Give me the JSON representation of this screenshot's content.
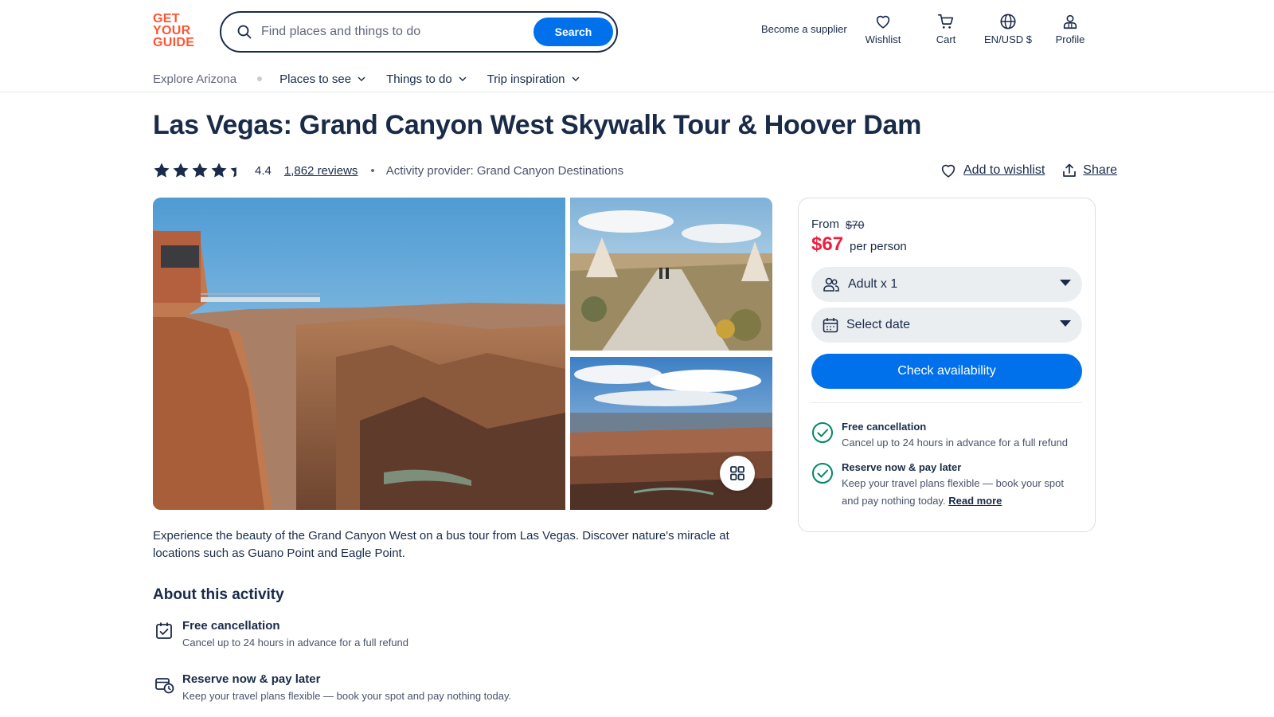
{
  "header": {
    "logo_lines": [
      "GET",
      "YOUR",
      "GUIDE"
    ],
    "search": {
      "placeholder": "Find places and things to do",
      "button_label": "Search"
    },
    "supplier_link": "Become a supplier",
    "nav": [
      {
        "label": "Wishlist",
        "icon": "heart-icon"
      },
      {
        "label": "Cart",
        "icon": "cart-icon"
      },
      {
        "label": "EN/USD $",
        "icon": "globe-icon"
      },
      {
        "label": "Profile",
        "icon": "profile-icon"
      }
    ]
  },
  "subnav": {
    "explore": "Explore Arizona",
    "items": [
      "Places to see",
      "Things to do",
      "Trip inspiration"
    ]
  },
  "activity": {
    "title": "Las Vegas: Grand Canyon West Skywalk Tour & Hoover Dam",
    "rating": "4.4",
    "rating_value": 4.4,
    "reviews": "1,862 reviews",
    "provider": "Activity provider: Grand Canyon Destinations",
    "add_to_wishlist": "Add to wishlist",
    "share": "Share",
    "description": "Experience the beauty of the Grand Canyon West on a bus tour from Las Vegas. Discover nature's miracle at locations such as Guano Point and Eagle Point."
  },
  "booking": {
    "from_label": "From",
    "old_price": "$70",
    "price": "$67",
    "per_person": "per person",
    "participants": "Adult x 1",
    "date": "Select date",
    "check_button": "Check availability",
    "perks": [
      {
        "title": "Free cancellation",
        "text": "Cancel up to 24 hours in advance for a full refund"
      },
      {
        "title": "Reserve now & pay later",
        "text": "Keep your travel plans flexible — book your spot and pay nothing today.",
        "link": "Read more"
      }
    ]
  },
  "about": {
    "heading": "About this activity",
    "items": [
      {
        "title": "Free cancellation",
        "text": "Cancel up to 24 hours in advance for a full refund"
      },
      {
        "title": "Reserve now & pay later",
        "text": "Keep your travel plans flexible — book your spot and pay nothing today."
      }
    ]
  },
  "colors": {
    "brand": "#ff5533",
    "primary": "#0071eb",
    "price": "#eb1f3f",
    "text": "#1a2b49",
    "success": "#008768"
  }
}
